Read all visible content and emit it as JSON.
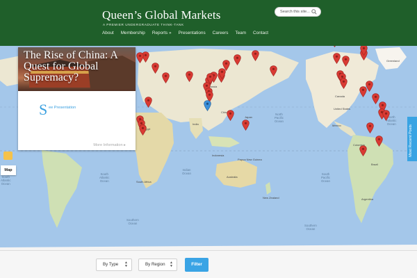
{
  "site": {
    "title": "Queen’s Global Markets",
    "tagline": "A PREMIER UNDERGRADUATE THINK-TANK"
  },
  "search": {
    "placeholder": "Search this site..."
  },
  "nav": [
    "About",
    "Membership",
    "Reports »",
    "Presentations",
    "Careers",
    "Team",
    "Contact"
  ],
  "map": {
    "oceans": [
      "North\nPacific\nOcean",
      "South\nPacific\nOcean",
      "South\nAtlantic\nOcean",
      "North\nAtlantic\nOcean",
      "Indian\nOcean",
      "Southern\nOcean",
      "Southern\nOcean",
      "South\nAtlantic\nOcean"
    ],
    "land_labels": [
      "Greenland",
      "Canada",
      "United States",
      "Mexico",
      "Brazil",
      "Argentina",
      "Colombia",
      "Australia",
      "New Zealand",
      "South Africa",
      "Egypt",
      "India",
      "China",
      "Russia",
      "Indonesia",
      "Papua New Guinea",
      "Japan"
    ],
    "map_type_label": "Map",
    "pin_color": "#d93a33",
    "highlight_pin_color": "#3b8fd9"
  },
  "card": {
    "title": "The Rise of China: A Quest for Global Supremacy?",
    "dropcap": "S",
    "text": "ee Presentation",
    "more": "More Information ▸"
  },
  "side_tab": {
    "label": "Most Recent Posts",
    "color": "#39a3e3"
  },
  "filters": {
    "type": "By Type",
    "region": "By Region",
    "button": "Filter",
    "button_color": "#3aa4e5"
  }
}
